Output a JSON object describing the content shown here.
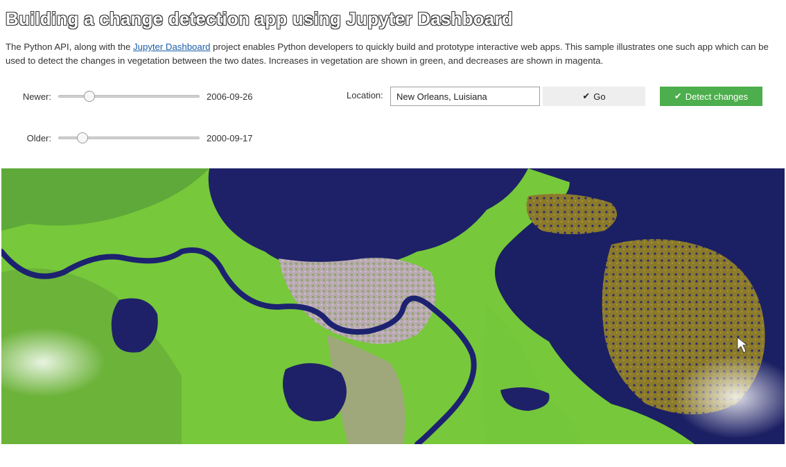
{
  "header": {
    "title": "Building a change detection app using Jupyter Dashboard"
  },
  "description": {
    "before_link": "The Python API, along with the ",
    "link_text": "Jupyter Dashboard",
    "after_link": " project enables Python developers to quickly build and prototype interactive web apps. This sample illustrates one such app which can be used to detect the changes in vegetation between the two dates. Increases in vegetation are shown in green, and decreases are shown in magenta."
  },
  "controls": {
    "newer": {
      "label": "Newer:",
      "value": "2006-09-26",
      "position": 0.22
    },
    "older": {
      "label": "Older:",
      "value": "2000-09-17",
      "position": 0.17
    },
    "location": {
      "label": "Location:",
      "value": "New Orleans, Luisiana"
    },
    "go_label": "Go",
    "detect_label": "Detect changes"
  },
  "icons": {
    "go_icon": "check-icon",
    "detect_icon": "check-icon"
  },
  "colors": {
    "detect_button": "#4cae4c",
    "go_button": "#eeeeee",
    "water": "#1d2166",
    "vegetation": "#7ccf3a",
    "urban": "#b7a7b8",
    "marsh": "#8a7a2e"
  }
}
